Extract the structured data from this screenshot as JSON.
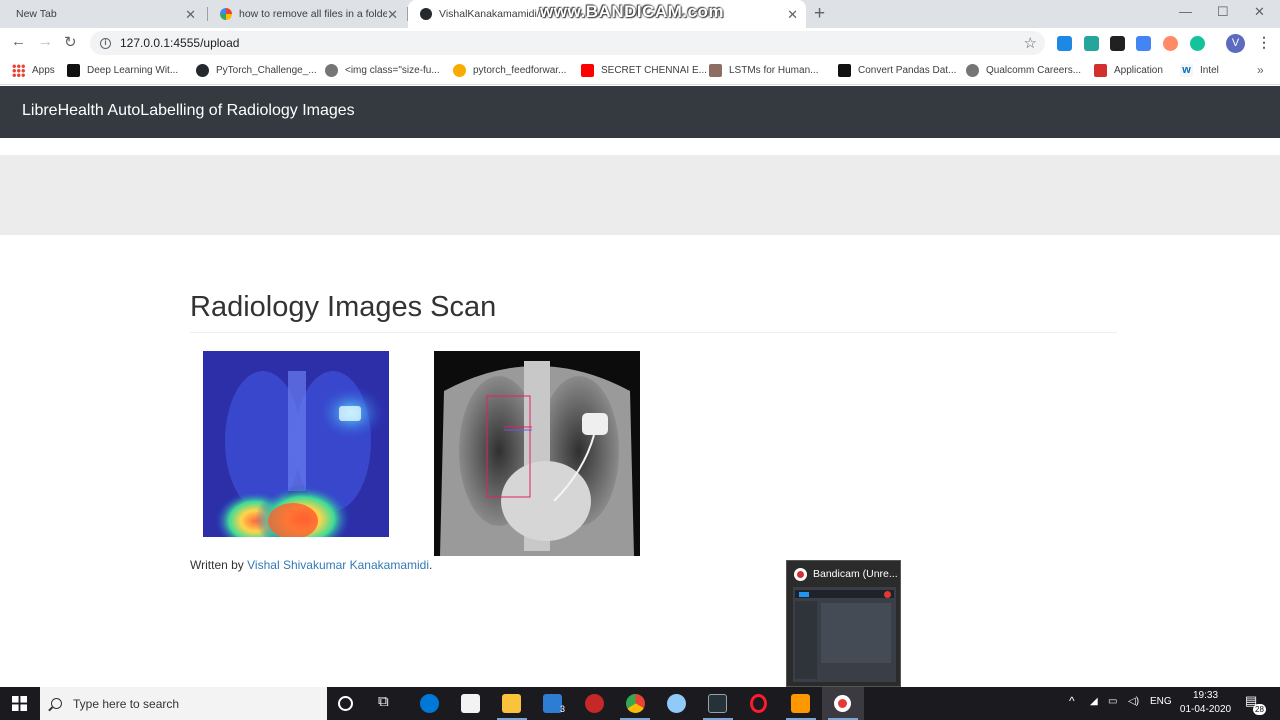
{
  "browser": {
    "tabs": [
      {
        "title": "New Tab",
        "favicon": "none"
      },
      {
        "title": "how to remove all files in a folde",
        "favicon": "google-icon"
      },
      {
        "title": "VishalKanakamamidi/De",
        "favicon": "github-icon"
      }
    ],
    "watermark": "www.BANDICAM.com",
    "url": "127.0.0.1:4555/upload",
    "bookmarks": [
      "Apps",
      "Deep Learning Wit...",
      "PyTorch_Challenge_...",
      "<img class=\"size-fu...",
      "pytorch_feedforwar...",
      "SECRET CHENNAI E...",
      "LSTMs for Human...",
      "Convert Pandas Dat...",
      "Qualcomm Careers...",
      "Application",
      "Intel"
    ],
    "bookmarks_more": "»",
    "profile_initial": "V"
  },
  "page": {
    "brand": "LibreHealth AutoLabelling of Radiology Images",
    "heading": "Radiology Images Scan",
    "footer_prefix": "Written by ",
    "footer_link": "Vishal Shivakumar Kanakamamidi",
    "footer_suffix": "."
  },
  "bandicam_popup": {
    "title": "Bandicam (Unre..."
  },
  "taskbar": {
    "search_placeholder": "Type here to search",
    "mail_badge": "3",
    "language": "ENG",
    "time": "19:33",
    "date": "01-04-2020",
    "notification_count": "28"
  },
  "colors": {
    "navbar": "#343a40",
    "jumbotron": "#ececec",
    "link": "#337ab7",
    "taskbar": "#1b1b1f"
  }
}
